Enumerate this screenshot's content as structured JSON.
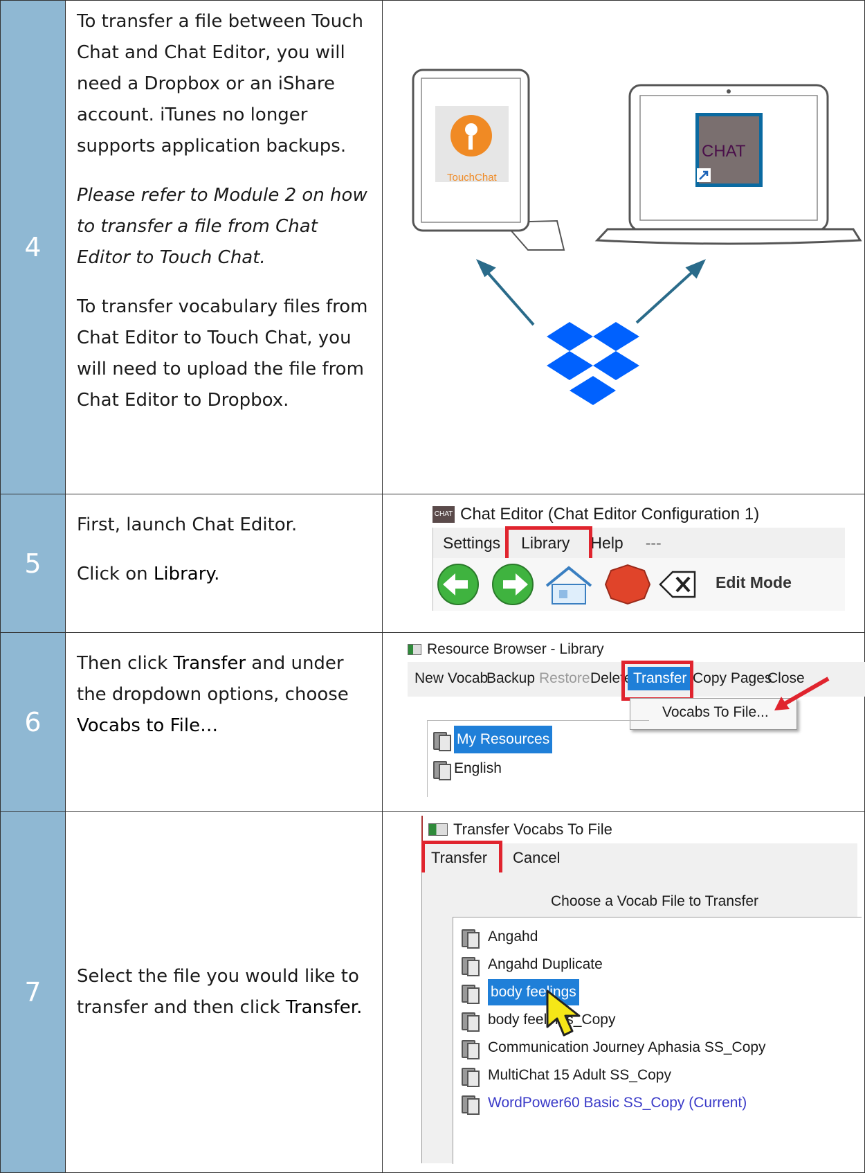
{
  "steps": [
    {
      "number": "4",
      "paragraphs": [
        "To transfer a file between Touch Chat and Chat Editor, you will need a Dropbox or an iShare account. iTunes no longer supports application backups.",
        "Please refer to Module 2 on how to transfer a file from Chat Editor to Touch Chat.",
        "To transfer vocabulary files from Chat Editor to Touch Chat, you will need to upload the file from Chat Editor to Dropbox."
      ],
      "touchchat_logo_text": "TouchChat",
      "chat_logo_text": "CHAT"
    },
    {
      "number": "5",
      "line1": "First, launch Chat Editor.",
      "line2_prefix": "Click on ",
      "line2_bold": "Library.",
      "window_title": "Chat Editor (Chat Editor Configuration 1)",
      "title_icon_text": "CHAT",
      "menu": [
        "Settings",
        "Library",
        "Help",
        "---"
      ],
      "edit_mode": "Edit Mode"
    },
    {
      "number": "6",
      "text_prefix": "Then click ",
      "text_bold1": "Transfer",
      "text_mid": " and under the dropdown options, choose ",
      "text_bold2": "Vocabs to File…",
      "window_title": "Resource Browser - Library",
      "menu": [
        "New Vocab",
        "Backup",
        "Restore",
        "Delete",
        "Transfer",
        "Copy Pages",
        "Close"
      ],
      "dropdown_item": "Vocabs To File...",
      "tree": [
        "My Resources",
        "English"
      ]
    },
    {
      "number": "7",
      "text_prefix": "Select the file you would like to transfer and then click ",
      "text_bold": "Transfer.",
      "window_title": "Transfer Vocabs To File",
      "menu": [
        "Transfer",
        "Cancel"
      ],
      "heading": "Choose a Vocab File to Transfer",
      "files": [
        "Angahd",
        "Angahd Duplicate",
        "body feelings",
        "body feelings_Copy",
        "Communication Journey Aphasia SS_Copy",
        "MultiChat 15 Adult SS_Copy",
        "WordPower60 Basic SS_Copy (Current)"
      ]
    }
  ],
  "colors": {
    "number_cell": "#8fb8d3",
    "highlight": "#e0242e",
    "selection": "#1f7fd8",
    "dropbox": "#0061fe",
    "current_file": "#3a3ac8"
  }
}
